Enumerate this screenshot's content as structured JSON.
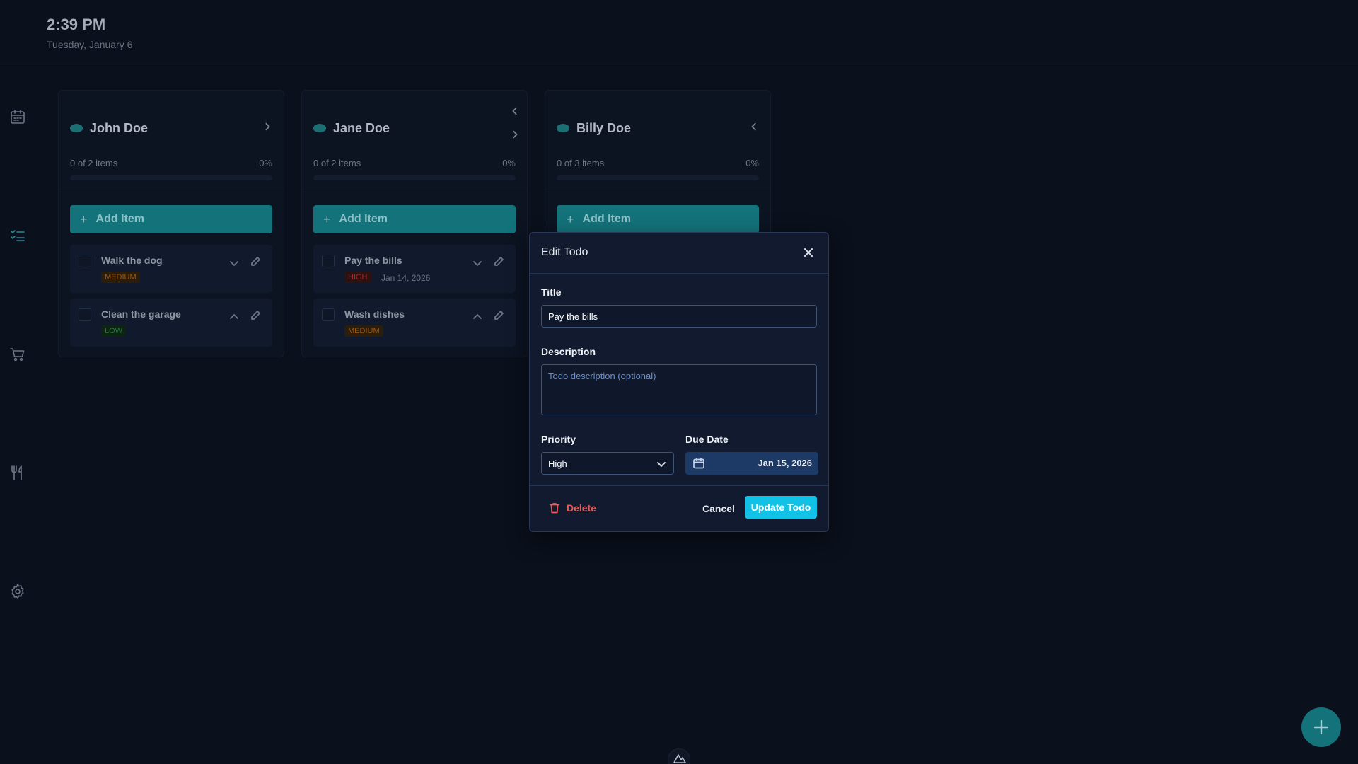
{
  "header": {
    "time": "2:39 PM",
    "date": "Tuesday, January 6"
  },
  "sidebar": {
    "items": [
      {
        "name": "calendar-icon"
      },
      {
        "name": "checklist-icon",
        "active": true
      },
      {
        "name": "cart-icon"
      },
      {
        "name": "utensils-icon"
      },
      {
        "name": "gear-icon"
      }
    ]
  },
  "columns": [
    {
      "name": "John Doe",
      "stats": "0 of 2 items",
      "percent": "0%",
      "progress": 0,
      "add_label": "Add Item",
      "todos": [
        {
          "title": "Walk the dog",
          "priority": "MEDIUM",
          "due": ""
        },
        {
          "title": "Clean the garage",
          "priority": "LOW",
          "due": ""
        }
      ]
    },
    {
      "name": "Jane Doe",
      "stats": "0 of 2 items",
      "percent": "0%",
      "progress": 0,
      "add_label": "Add Item",
      "todos": [
        {
          "title": "Pay the bills",
          "priority": "HIGH",
          "due": "Jan 14, 2026"
        },
        {
          "title": "Wash dishes",
          "priority": "MEDIUM",
          "due": ""
        }
      ]
    },
    {
      "name": "Billy Doe",
      "stats": "0 of 3 items",
      "percent": "0%",
      "progress": 0,
      "add_label": "Add Item",
      "todos": []
    }
  ],
  "modal": {
    "title": "Edit Todo",
    "title_label": "Title",
    "title_value": "Pay the bills",
    "description_label": "Description",
    "description_placeholder": "Todo description (optional)",
    "priority_label": "Priority",
    "priority_value": "High",
    "due_label": "Due Date",
    "due_value": "Jan 15, 2026",
    "delete_label": "Delete",
    "cancel_label": "Cancel",
    "update_label": "Update Todo"
  },
  "colors": {
    "accent": "#14727a",
    "primary_button": "#11c2e6",
    "danger": "#e25b5b",
    "background": "#0a101c"
  }
}
